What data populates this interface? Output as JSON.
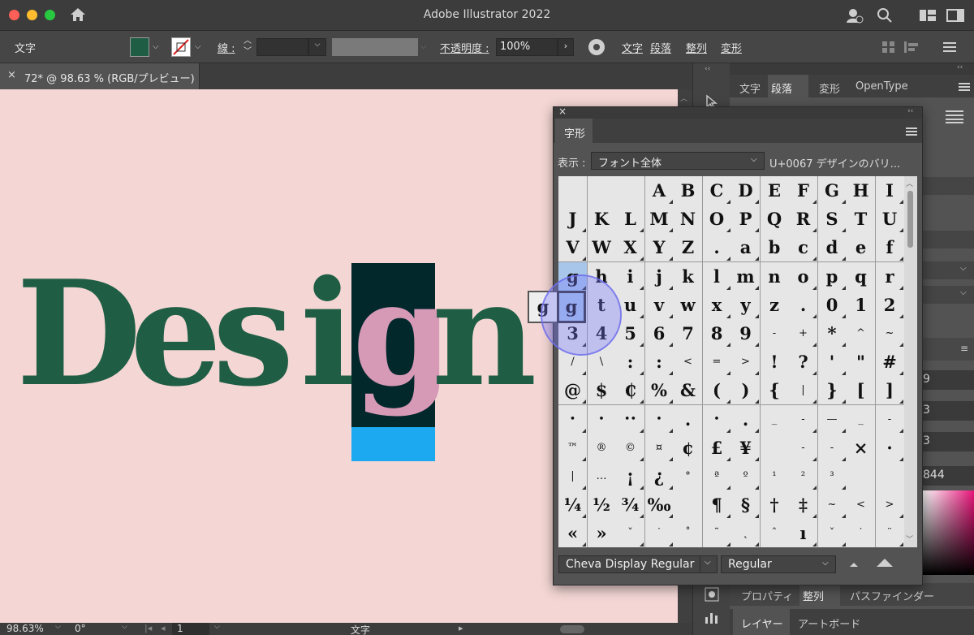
{
  "window": {
    "title": "Adobe Illustrator 2022"
  },
  "control_bar": {
    "type_label": "文字",
    "stroke_label": "線 :",
    "opacity_label": "不透明度 :",
    "opacity_value": "100%",
    "links": [
      "文字",
      "段落",
      "整列",
      "変形"
    ],
    "fill_color": "#1f5e44"
  },
  "document_tab": {
    "title": "72* @ 98.63 % (RGB/プレビュー)"
  },
  "artwork": {
    "word": "Design",
    "letters": [
      "D",
      "e",
      "s",
      "i",
      "g",
      "n"
    ],
    "green": "#1f5e44",
    "pink": "#d79ab6",
    "dark": "#03282c",
    "blue": "#1ca9ef",
    "bg": "#f4d7d5"
  },
  "status_bar": {
    "zoom": "98.63%",
    "rotation": "0°",
    "artboard": "1",
    "tool": "文字"
  },
  "right_panel": {
    "tabs": [
      "文字",
      "段落",
      "変形",
      "OpenType"
    ],
    "active_tab": "段落",
    "values": [
      "9",
      "3",
      "3"
    ],
    "hex": "844",
    "bottom_tabs": [
      "プロパティ",
      "整列",
      "パスファインダー"
    ],
    "bottom_tabs2": [
      "レイヤー",
      "アートボード"
    ]
  },
  "glyph_panel": {
    "title": "字形",
    "show_label": "表示 :",
    "show_value": "フォント全体",
    "info": "U+0067 デザインのバリ...",
    "font": "Cheva Display Regular",
    "style": "Regular",
    "rows": [
      [
        "",
        "",
        "",
        "A",
        "B",
        "C",
        "D",
        "E",
        "F",
        "G",
        "H",
        "I"
      ],
      [
        "J",
        "K",
        "L",
        "M",
        "N",
        "O",
        "P",
        "Q",
        "R",
        "S",
        "T",
        "U"
      ],
      [
        "V",
        "W",
        "X",
        "Y",
        "Z",
        ".",
        "a",
        "b",
        "c",
        "d",
        "e",
        "f"
      ],
      [
        "g",
        "h",
        "i",
        "j",
        "k",
        "l",
        "m",
        "n",
        "o",
        "p",
        "q",
        "r"
      ],
      [
        "s",
        "t",
        "u",
        "v",
        "w",
        "x",
        "y",
        "z",
        ".",
        "0",
        "1",
        "2"
      ],
      [
        "3",
        "4",
        "5",
        "6",
        "7",
        "8",
        "9",
        "-",
        "+",
        "*",
        "^",
        "~"
      ],
      [
        "/",
        "\\",
        ":",
        ":",
        "<",
        "=",
        ">",
        "!",
        "?",
        "'",
        "\"",
        "#"
      ],
      [
        "@",
        "$",
        "₵",
        "%",
        "&",
        "(",
        ")",
        "{",
        "|",
        "}",
        "[",
        "]"
      ],
      [
        "•",
        "•",
        "••",
        "•",
        ".",
        "•",
        ".",
        "_",
        "-",
        "—",
        "_",
        "-"
      ],
      [
        "™",
        "®",
        "©",
        "¤",
        "¢",
        "£",
        "¥",
        "",
        "-",
        "-",
        "×",
        "·"
      ],
      [
        "|",
        "…",
        "¡",
        "¿",
        "°",
        "ª",
        "º",
        "¹",
        "²",
        "³",
        "",
        ""
      ],
      [
        "¼",
        "½",
        "¾",
        "‰",
        "",
        "¶",
        "§",
        "†",
        "‡",
        "~",
        "<",
        ">"
      ],
      [
        "«",
        "»",
        "ˇ",
        "˙",
        "˚",
        "˜",
        "˛",
        "ˆ",
        "ı",
        "ˇ",
        "˙",
        "¨"
      ]
    ],
    "alternates": [
      "g",
      "g"
    ],
    "selected": "g"
  }
}
